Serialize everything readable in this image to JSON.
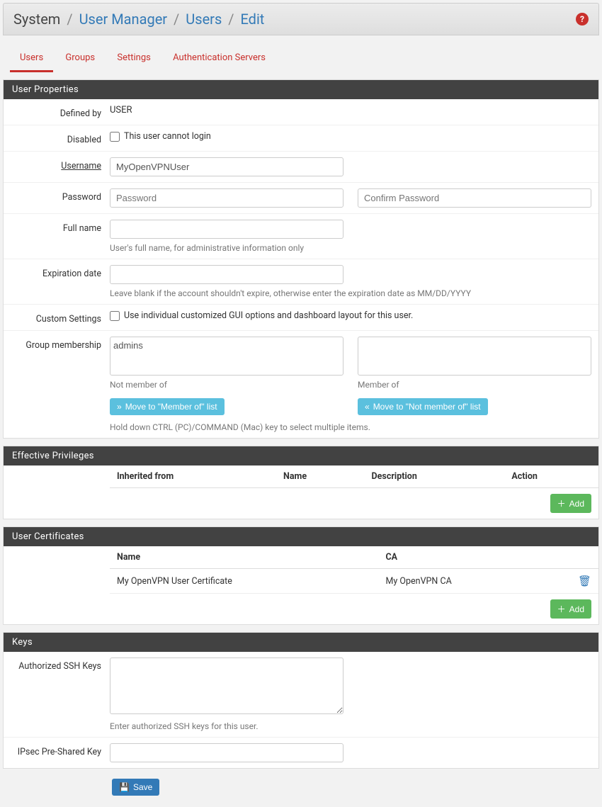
{
  "breadcrumb": {
    "root": "System",
    "parts": [
      "User Manager",
      "Users",
      "Edit"
    ]
  },
  "tabs": [
    "Users",
    "Groups",
    "Settings",
    "Authentication Servers"
  ],
  "activeTab": "Users",
  "panels": {
    "userProps": {
      "title": "User Properties",
      "definedBy": {
        "label": "Defined by",
        "value": "USER"
      },
      "disabled": {
        "label": "Disabled",
        "text": "This user cannot login",
        "checked": false
      },
      "username": {
        "label": "Username",
        "value": "MyOpenVPNUser"
      },
      "password": {
        "label": "Password",
        "placeholder1": "Password",
        "placeholder2": "Confirm Password"
      },
      "fullname": {
        "label": "Full name",
        "value": "",
        "hint": "User's full name, for administrative information only"
      },
      "expiration": {
        "label": "Expiration date",
        "value": "",
        "hint": "Leave blank if the account shouldn't expire, otherwise enter the expiration date as MM/DD/YYYY"
      },
      "custom": {
        "label": "Custom Settings",
        "text": "Use individual customized GUI options and dashboard layout for this user.",
        "checked": false
      },
      "groups": {
        "label": "Group membership",
        "notMemberOf": [
          "admins"
        ],
        "memberOf": [],
        "notMemberLabel": "Not member of",
        "memberLabel": "Member of",
        "moveToMember": "Move to \"Member of\" list",
        "moveToNotMember": "Move to \"Not member of\" list",
        "hint": "Hold down CTRL (PC)/COMMAND (Mac) key to select multiple items."
      }
    },
    "privileges": {
      "title": "Effective Privileges",
      "headers": [
        "Inherited from",
        "Name",
        "Description",
        "Action"
      ],
      "rows": [],
      "add": "Add"
    },
    "certs": {
      "title": "User Certificates",
      "headers": [
        "Name",
        "CA"
      ],
      "rows": [
        {
          "name": "My OpenVPN User Certificate",
          "ca": "My OpenVPN CA"
        }
      ],
      "add": "Add"
    },
    "keys": {
      "title": "Keys",
      "ssh": {
        "label": "Authorized SSH Keys",
        "value": "",
        "hint": "Enter authorized SSH keys for this user."
      },
      "ipsec": {
        "label": "IPsec Pre-Shared Key",
        "value": ""
      }
    }
  },
  "save": "Save"
}
